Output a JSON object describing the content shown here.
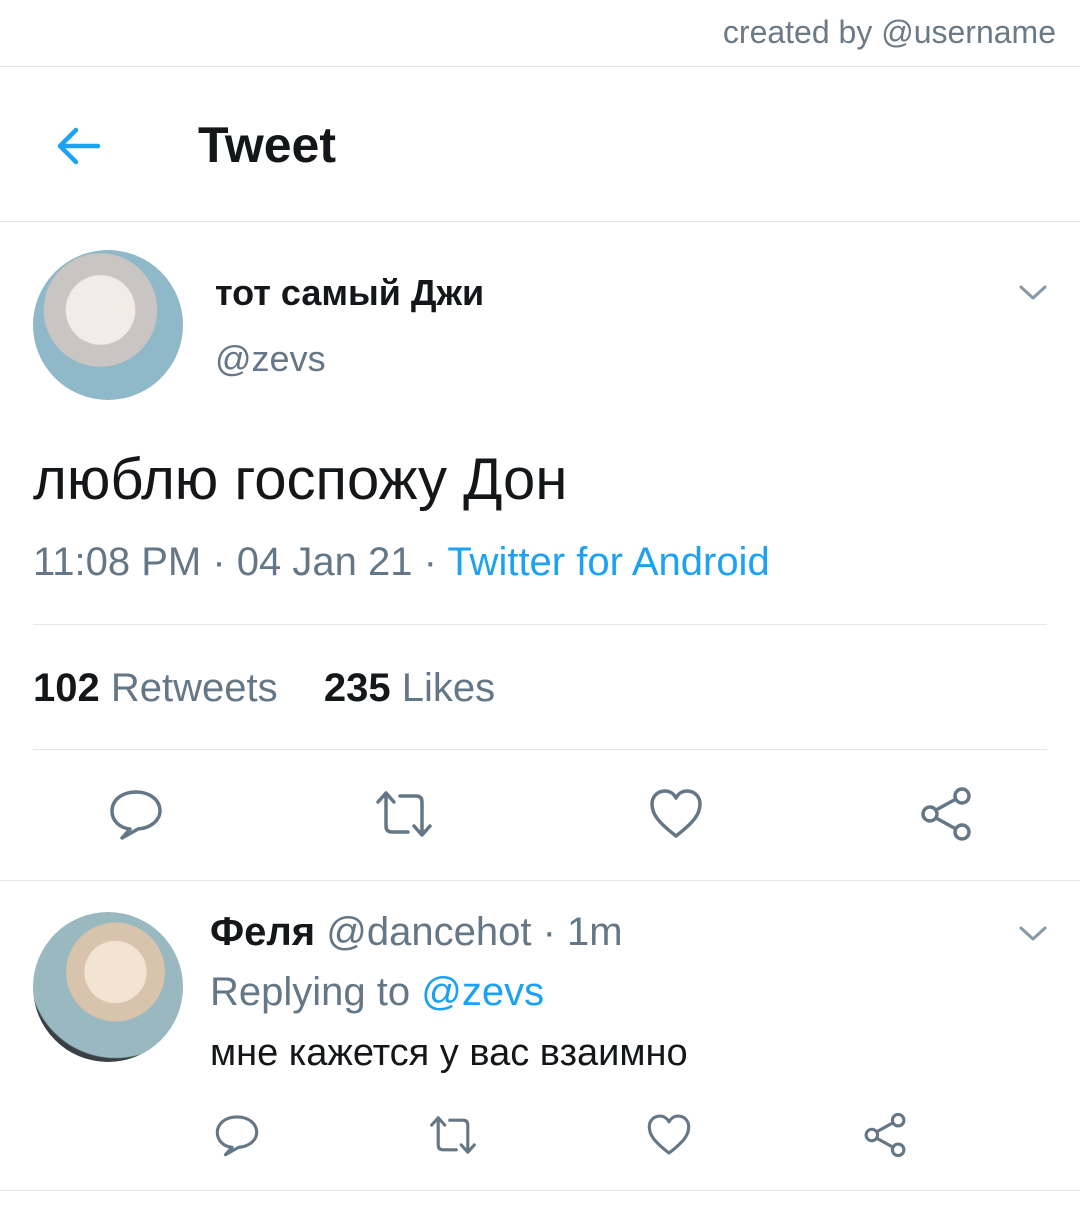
{
  "watermark": "created by @username",
  "header": {
    "title": "Tweet",
    "back_icon": "arrow-left-icon"
  },
  "tweet": {
    "display_name": "тот самый Джи",
    "handle": "@zevs",
    "text": "люблю госпожу Дон",
    "time": "11:08 PM",
    "sep1": " · ",
    "date": "04 Jan 21",
    "sep2": " · ",
    "source": "Twitter for Android",
    "retweet_count": "102",
    "retweet_label": "Retweets",
    "like_count": "235",
    "like_label": "Likes"
  },
  "reply": {
    "display_name": "Феля",
    "handle": "@dancehot",
    "sep": " · ",
    "age": "1m",
    "replying_prefix": "Replying to ",
    "replying_to": "@zevs",
    "text": "мне кажется у вас взаимно"
  },
  "colors": {
    "accent": "#1da1f2",
    "muted": "#657786",
    "divider": "#e1e8ed",
    "text": "#14171a"
  }
}
